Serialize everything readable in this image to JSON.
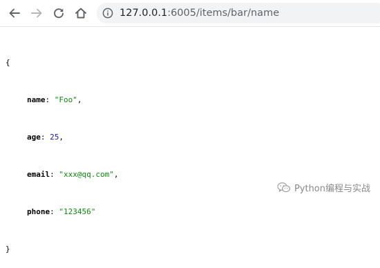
{
  "toolbar": {
    "back_icon": "arrow-left-icon",
    "forward_icon": "arrow-right-icon",
    "reload_icon": "reload-icon",
    "home_icon": "home-icon",
    "info_icon": "info-icon"
  },
  "address_bar": {
    "host": "127.0.0.1",
    "path": ":6005/items/bar/name"
  },
  "json_view": {
    "open_brace": "{",
    "close_brace": "}",
    "entries": [
      {
        "key": "name",
        "value": "\"Foo\"",
        "type": "string",
        "trail": ","
      },
      {
        "key": "age",
        "value": "25",
        "type": "number",
        "trail": ","
      },
      {
        "key": "email",
        "value": "\"xxx@qq.com\"",
        "type": "string",
        "trail": ","
      },
      {
        "key": "phone",
        "value": "\"123456\"",
        "type": "string",
        "trail": ""
      }
    ]
  },
  "watermark": {
    "icon": "wechat-icon",
    "text": "Python编程与实战"
  },
  "colors": {
    "string": "#0b8a0b",
    "number": "#1a1aa6",
    "omnibox_bg": "#f1f3f4"
  }
}
